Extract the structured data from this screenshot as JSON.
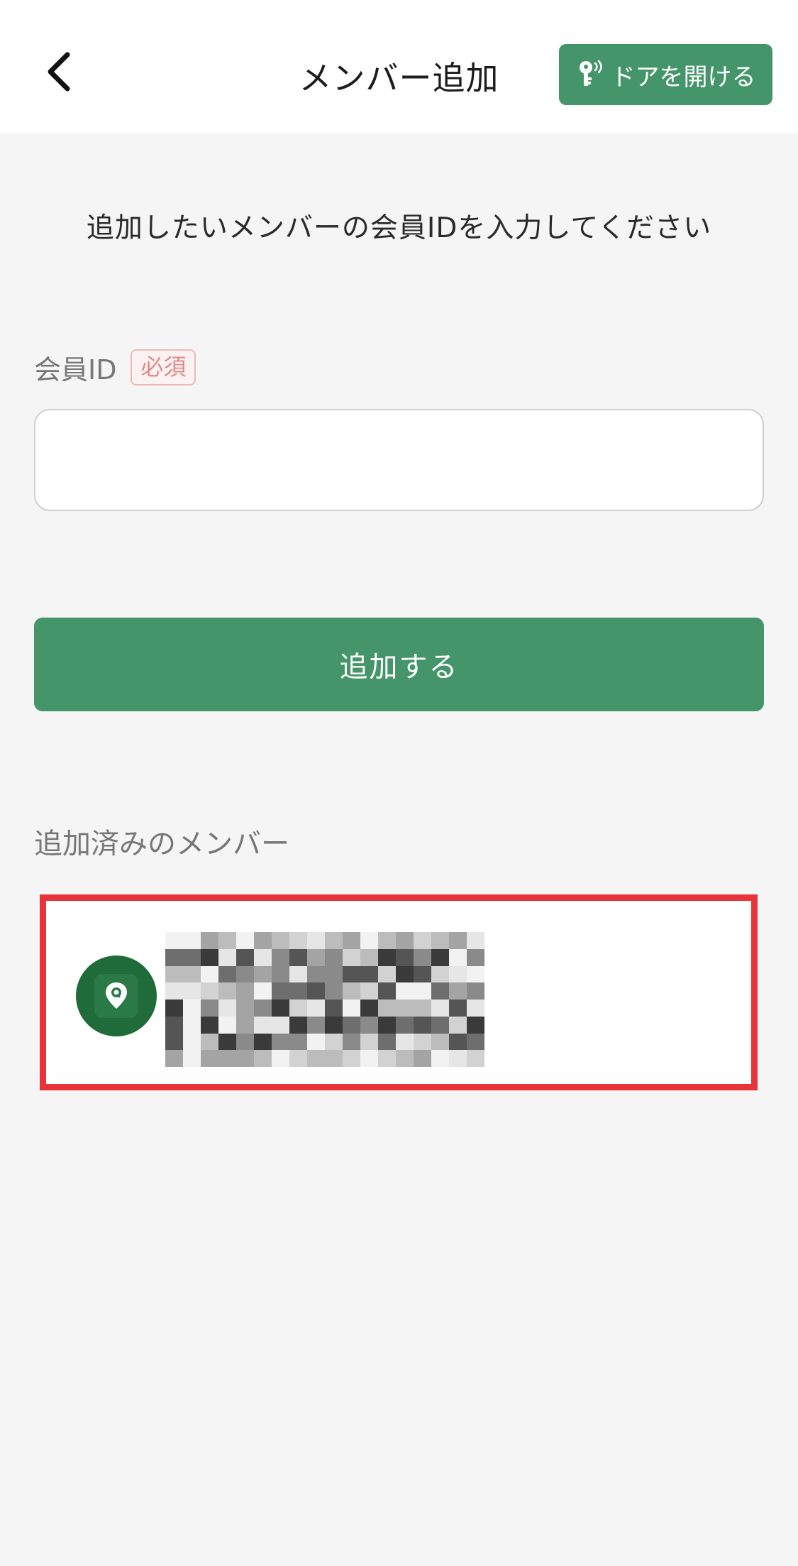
{
  "header": {
    "title": "メンバー追加",
    "open_door_label": "ドアを開ける",
    "back_icon": "chevron-left-icon",
    "door_icon": "key-wireless-icon"
  },
  "instruction": "追加したいメンバーの会員IDを入力してください",
  "form": {
    "field_label": "会員ID",
    "required_badge": "必須",
    "input_value": "",
    "input_placeholder": "",
    "submit_label": "追加する"
  },
  "members": {
    "section_title": "追加済みのメンバー",
    "items": [
      {
        "avatar_icon": "location-pin-icon",
        "name_redacted": true
      }
    ]
  },
  "colors": {
    "accent_green": "#44956a",
    "avatar_green": "#1f6b3a",
    "highlight_red": "#e8333a",
    "required_text": "#e08a8a"
  }
}
